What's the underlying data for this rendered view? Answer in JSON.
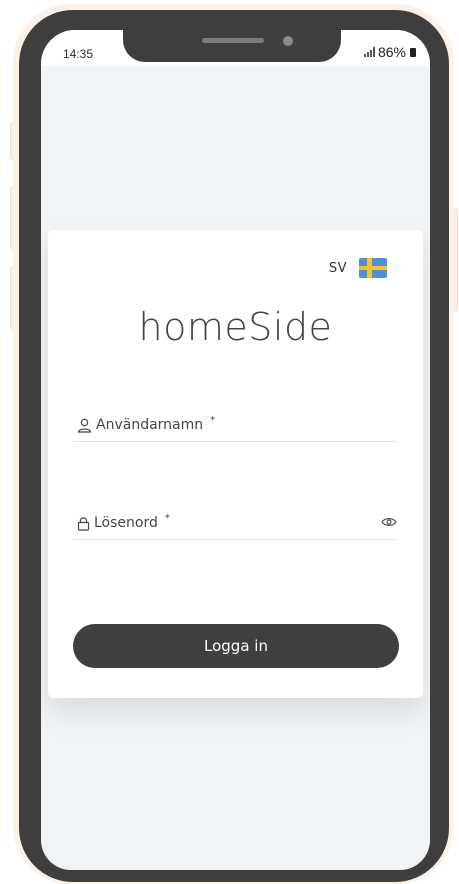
{
  "status_bar": {
    "time": "14:35",
    "battery": "86%"
  },
  "login": {
    "language_code": "SV",
    "logo_text": "homeSide",
    "username_label": "Användarnamn",
    "username_required": "*",
    "password_label": "Lösenord",
    "password_required": "*",
    "login_button": "Logga in"
  },
  "icons": {
    "language_flag": "sweden-flag-icon",
    "username": "user-icon",
    "password": "lock-icon",
    "password_toggle": "eye-icon"
  },
  "colors": {
    "button": "#3f3f3f",
    "phone_frame": "#3e3e3e",
    "screen_background": "#f1f4f6",
    "flag_blue": "#4f8fd3",
    "flag_yellow": "#f5c432"
  }
}
